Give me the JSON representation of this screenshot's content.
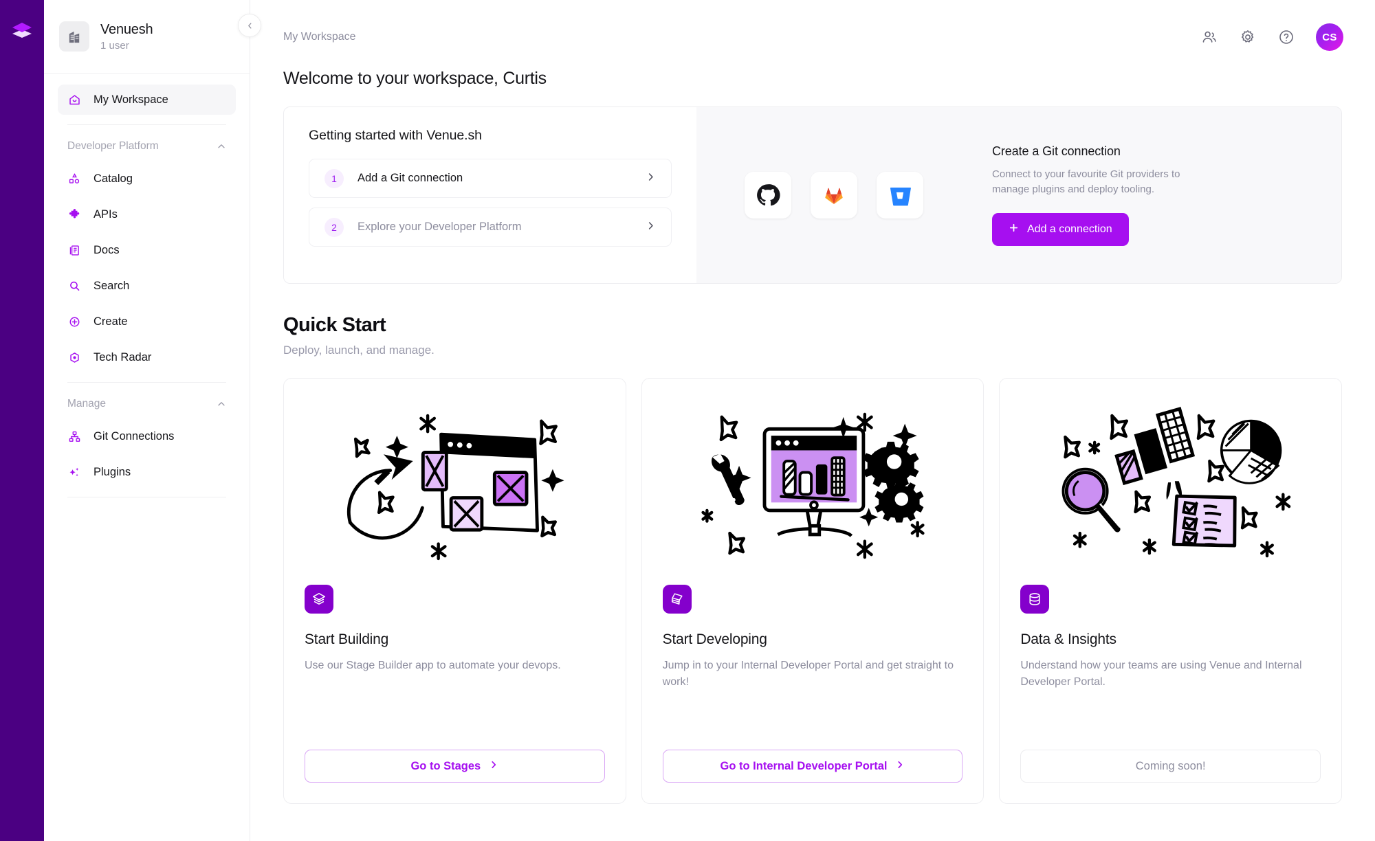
{
  "brand": {
    "logo_icon": "layers-logo-icon",
    "accent": "#a60ff0",
    "rail_color": "#4b0082"
  },
  "sidebar": {
    "workspace": {
      "icon": "building-icon",
      "name": "Venuesh",
      "users": "1 user"
    },
    "collapse_icon": "chevron-left-icon",
    "primary": {
      "icon": "home-icon",
      "label": "My Workspace"
    },
    "groups": [
      {
        "title": "Developer Platform",
        "chevron": "chevron-up-icon",
        "items": [
          {
            "icon": "catalog-shapes-icon",
            "label": "Catalog"
          },
          {
            "icon": "puzzle-piece-icon",
            "label": "APIs"
          },
          {
            "icon": "docs-book-icon",
            "label": "Docs"
          },
          {
            "icon": "search-icon",
            "label": "Search"
          },
          {
            "icon": "plus-circle-icon",
            "label": "Create"
          },
          {
            "icon": "radar-target-icon",
            "label": "Tech Radar"
          }
        ]
      },
      {
        "title": "Manage",
        "chevron": "chevron-up-icon",
        "items": [
          {
            "icon": "git-connections-icon",
            "label": "Git Connections"
          },
          {
            "icon": "sparkles-plugins-icon",
            "label": "Plugins"
          }
        ]
      }
    ]
  },
  "topbar": {
    "breadcrumb": "My Workspace",
    "icons": [
      {
        "name": "users-icon"
      },
      {
        "name": "gear-icon"
      },
      {
        "name": "help-circle-icon"
      }
    ],
    "avatar_initials": "CS"
  },
  "page": {
    "welcome": "Welcome to your workspace, Curtis"
  },
  "getting_started": {
    "title": "Getting started with Venue.sh",
    "steps": [
      {
        "num": "1",
        "label": "Add a Git connection",
        "chevron": "chevron-right-icon",
        "dim": false
      },
      {
        "num": "2",
        "label": "Explore your Developer Platform",
        "chevron": "chevron-right-icon",
        "dim": true
      }
    ],
    "providers": [
      {
        "name": "github-logo-icon"
      },
      {
        "name": "gitlab-logo-icon"
      },
      {
        "name": "bitbucket-logo-icon"
      }
    ],
    "cta": {
      "title": "Create a Git connection",
      "desc": "Connect to your favourite Git providers to manage plugins and deploy tooling.",
      "button_label": "Add a connection",
      "button_icon": "plus-icon"
    }
  },
  "quick_start": {
    "title": "Quick Start",
    "subtitle": "Deploy, launch, and manage.",
    "cards": [
      {
        "art": "browser-wireframe-illustration",
        "icon": "layers-icon",
        "title": "Start Building",
        "desc": "Use our Stage Builder app to automate your devops.",
        "button_label": "Go to Stages",
        "button_icon": "chevron-right-icon",
        "disabled": false
      },
      {
        "art": "monitor-chart-tools-illustration",
        "icon": "stacked-cards-icon",
        "title": "Start Developing",
        "desc": "Jump in to your Internal Developer Portal and get straight to work!",
        "button_label": "Go to Internal Developer Portal",
        "button_icon": "chevron-right-icon",
        "disabled": false
      },
      {
        "art": "analytics-magnifier-illustration",
        "icon": "database-icon",
        "title": "Data & Insights",
        "desc": "Understand how your teams are using Venue and Internal Developer Portal.",
        "button_label": "Coming soon!",
        "button_icon": "",
        "disabled": true
      }
    ]
  }
}
